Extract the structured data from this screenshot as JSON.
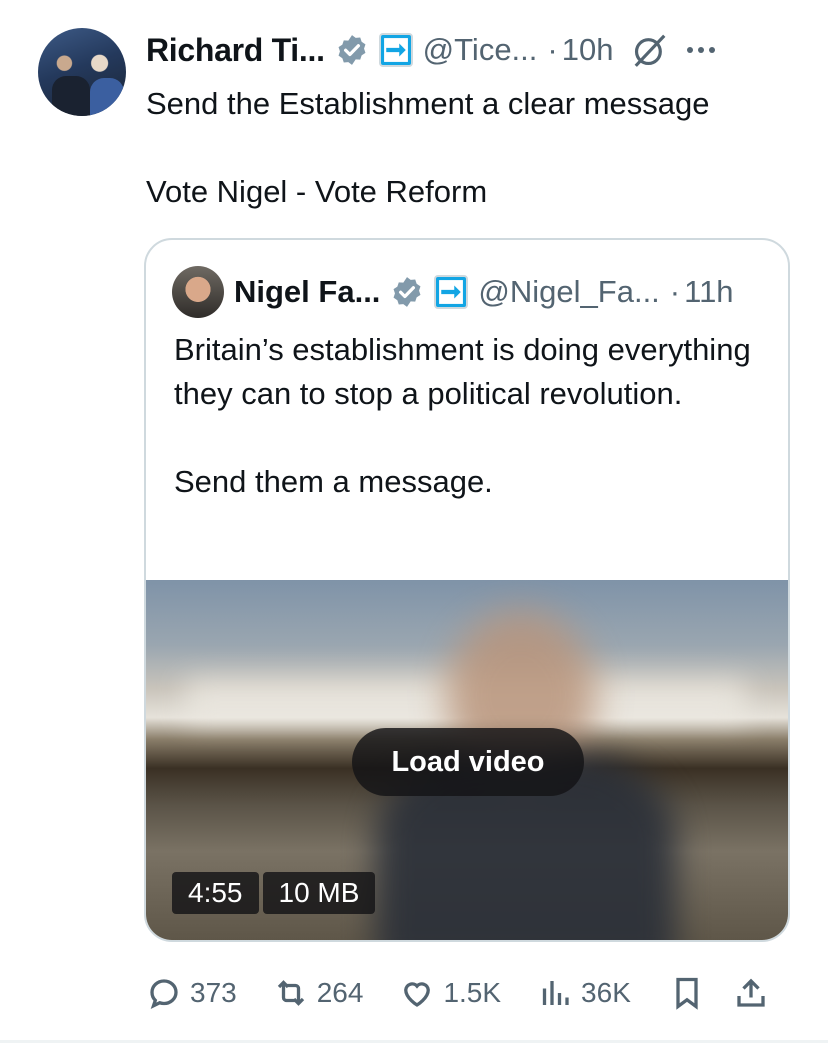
{
  "tweet": {
    "author_name": "Richard Ti...",
    "handle": "@Tice...",
    "dot": "·",
    "time": "10h",
    "text": "Send the Establishment a clear message\n\nVote Nigel - Vote Reform"
  },
  "quote": {
    "author_name": "Nigel Fa...",
    "handle": "@Nigel_Fa...",
    "dot": "·",
    "time": "11h",
    "text": "Britain’s establishment is doing everything they can to stop a political revolution.\n\nSend them a message.",
    "video": {
      "load_label": "Load video",
      "duration": "4:55",
      "size": "10 MB"
    }
  },
  "actions": {
    "replies": "373",
    "reposts": "264",
    "likes": "1.5K",
    "views": "36K"
  },
  "colors": {
    "verified": "#829aab",
    "affiliate_badge": "#12a5e4",
    "muted": "#536471"
  },
  "icons": [
    "verified-icon",
    "reform-uk-badge-icon",
    "grok-icon",
    "more-icon",
    "reply-icon",
    "repost-icon",
    "like-icon",
    "views-icon",
    "bookmark-icon",
    "share-icon"
  ]
}
